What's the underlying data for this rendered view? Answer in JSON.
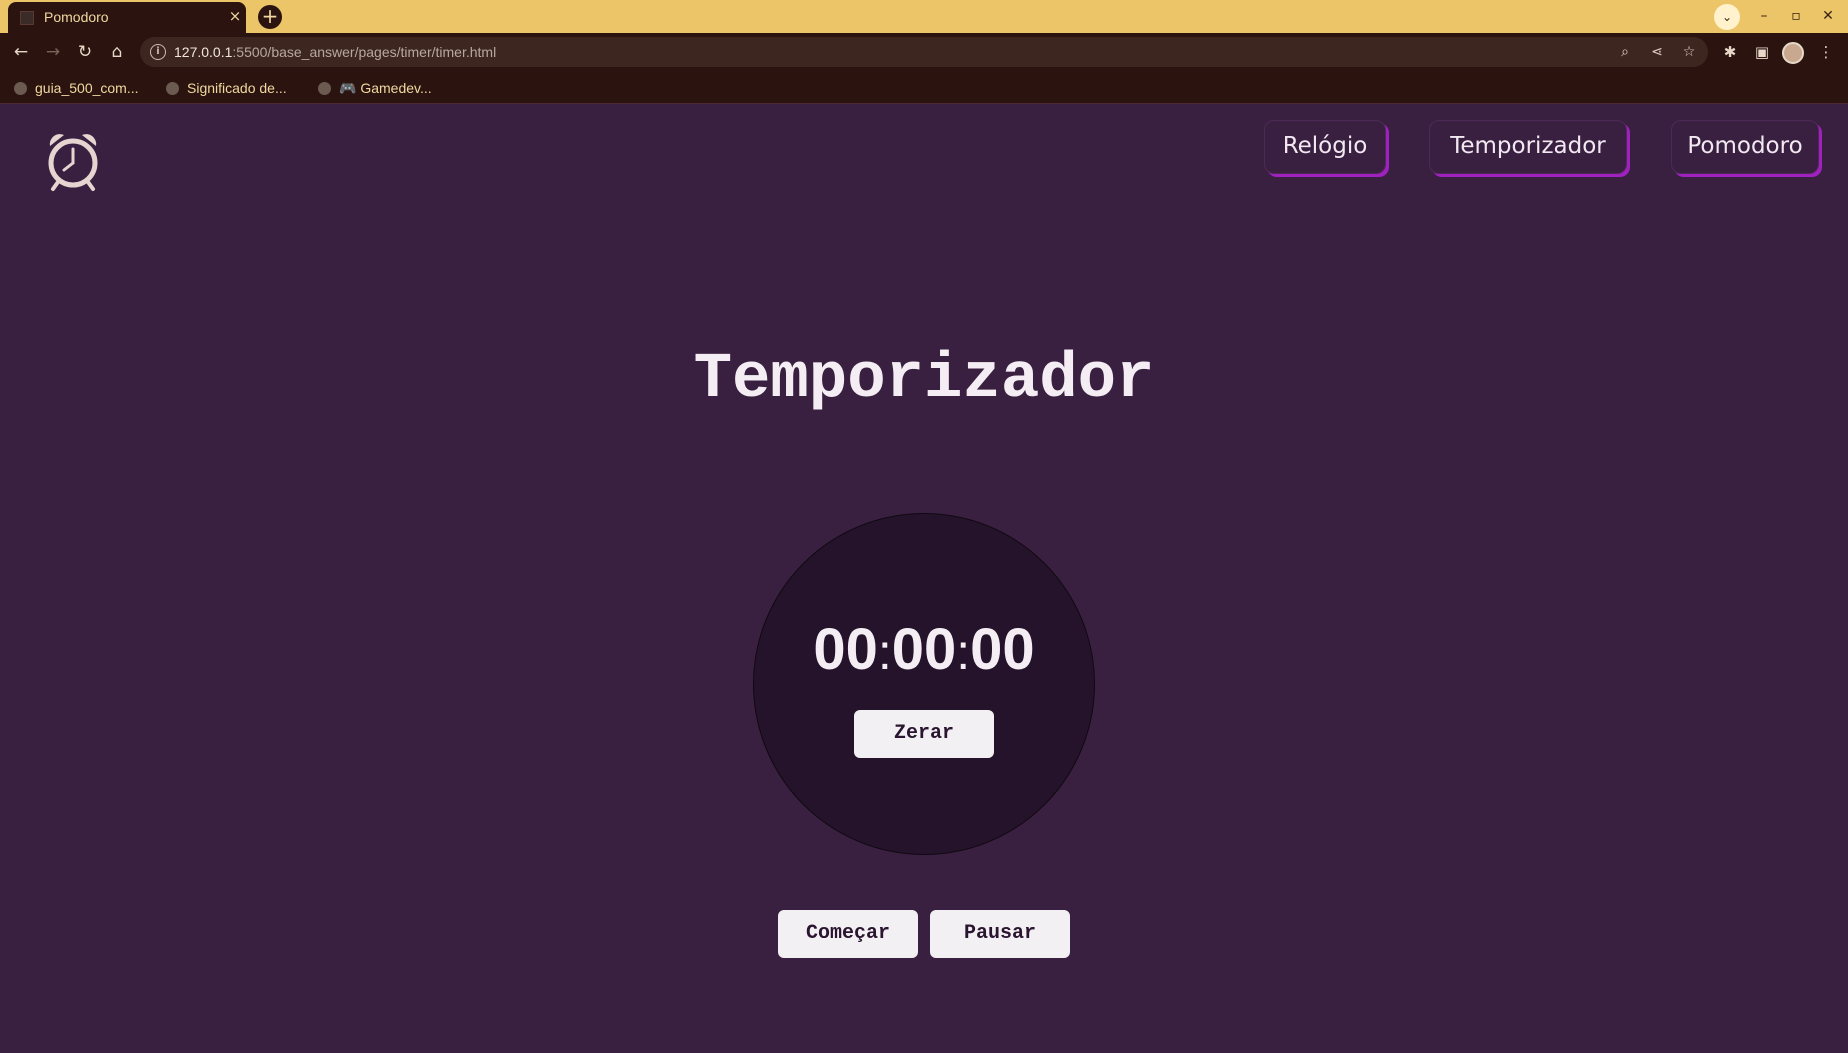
{
  "browser": {
    "tab_title": "Pomodoro",
    "tab_close": "×",
    "new_tab": "+",
    "url_host": "127.0.0.1",
    "url_rest": ":5500/base_answer/pages/timer/timer.html",
    "bookmarks": [
      "guia_500_com...",
      "Significado de...",
      "🎮 Gamedev..."
    ],
    "colors": {
      "tabbar": "#ecc569",
      "chrome": "#2b1410"
    }
  },
  "nav": {
    "links": [
      "Relógio",
      "Temporizador",
      "Pomodoro"
    ]
  },
  "main": {
    "title": "Temporizador",
    "time": {
      "hours": "00",
      "minutes": "00",
      "seconds": "00",
      "separator": ":"
    },
    "reset_label": "Zerar",
    "start_label": "Começar",
    "pause_label": "Pausar"
  },
  "colors": {
    "page_bg": "#3a2040",
    "circle_bg": "#24132a",
    "accent": "#a020c0",
    "button_bg": "#f2f0f2"
  },
  "icons": [
    "alarm-clock-icon",
    "back-icon",
    "forward-icon",
    "reload-icon",
    "home-icon",
    "zoom-icon",
    "share-icon",
    "star-icon",
    "extensions-icon",
    "side-panel-icon",
    "menu-icon"
  ]
}
